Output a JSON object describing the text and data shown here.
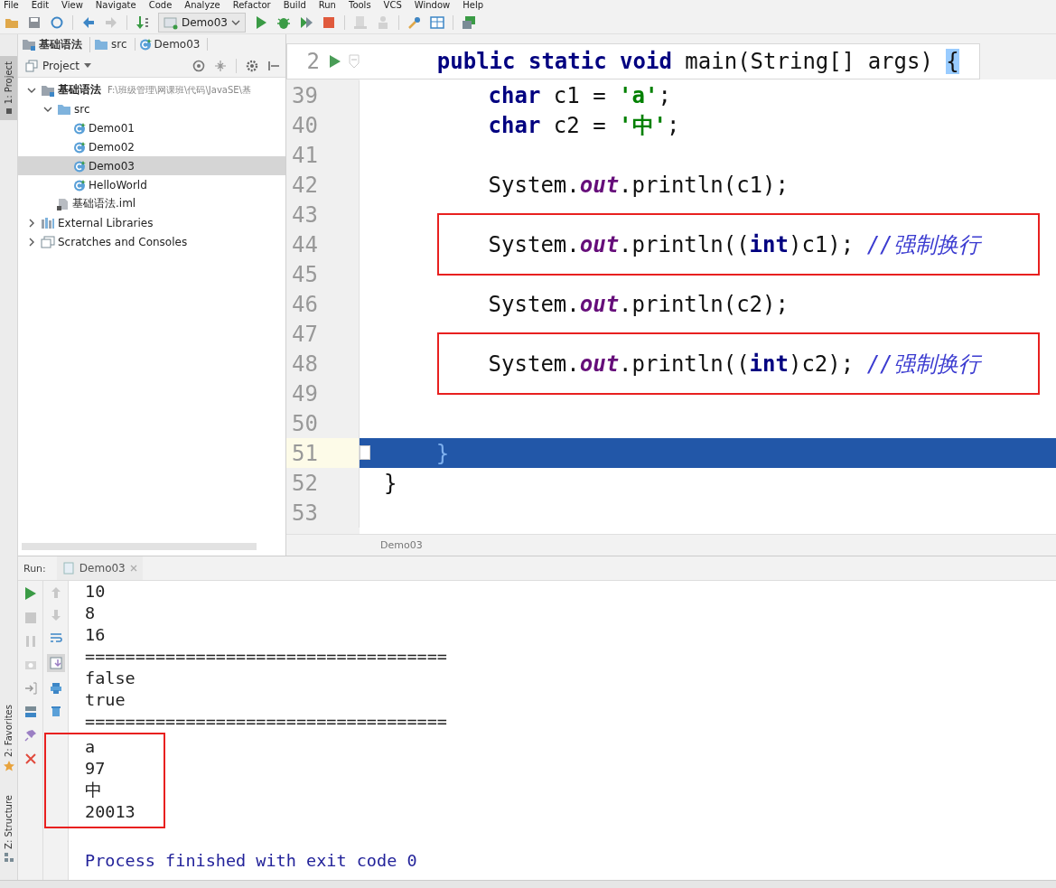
{
  "menu_bar": [
    "File",
    "Edit",
    "View",
    "Navigate",
    "Code",
    "Analyze",
    "Refactor",
    "Build",
    "Run",
    "Tools",
    "VCS",
    "Window",
    "Help"
  ],
  "toolbar": {
    "run_config": "Demo03"
  },
  "breadcrumbs": [
    {
      "label": "基础语法",
      "kind": "module"
    },
    {
      "label": "src",
      "kind": "folder"
    },
    {
      "label": "Demo03",
      "kind": "class"
    }
  ],
  "left_strip": {
    "top": [
      {
        "label": "1: Project",
        "selected": true
      }
    ],
    "bottom": [
      {
        "label": "2: Favorites",
        "selected": false
      },
      {
        "label": "Z: Structure",
        "selected": false
      }
    ]
  },
  "project_panel": {
    "title": "Project",
    "tree": [
      {
        "label": "基础语法",
        "path": "F:\\班级管理\\网课班\\代码\\JavaSE\\基",
        "kind": "module",
        "expanded": true,
        "selected": false,
        "children": [
          {
            "label": "src",
            "kind": "folder",
            "expanded": true,
            "selected": false,
            "children": [
              {
                "label": "Demo01",
                "kind": "class",
                "selected": false
              },
              {
                "label": "Demo02",
                "kind": "class",
                "selected": false
              },
              {
                "label": "Demo03",
                "kind": "class",
                "selected": true
              },
              {
                "label": "HelloWorld",
                "kind": "class",
                "selected": false
              }
            ]
          },
          {
            "label": "基础语法.iml",
            "kind": "file",
            "selected": false
          }
        ]
      },
      {
        "label": "External Libraries",
        "kind": "library",
        "expanded": false,
        "selected": false
      },
      {
        "label": "Scratches and Consoles",
        "kind": "scratch",
        "expanded": false,
        "selected": false
      }
    ]
  },
  "editor": {
    "sticky_line": {
      "number": "2",
      "tokens": [
        {
          "kind": "keyword",
          "text": "    public static void"
        },
        {
          "kind": "plain",
          "text": " main(String[] args) "
        },
        {
          "kind": "brace_match",
          "text": "{"
        }
      ]
    },
    "lines": [
      {
        "number": "39",
        "highlighted": false,
        "boxed": false,
        "tokens": [
          {
            "kind": "keyword",
            "text": "        char"
          },
          {
            "kind": "plain",
            "text": " c1 = "
          },
          {
            "kind": "string",
            "text": "'a'"
          },
          {
            "kind": "plain",
            "text": ";"
          }
        ]
      },
      {
        "number": "40",
        "highlighted": false,
        "boxed": false,
        "tokens": [
          {
            "kind": "keyword",
            "text": "        char"
          },
          {
            "kind": "plain",
            "text": " c2 = "
          },
          {
            "kind": "string",
            "text": "'中'"
          },
          {
            "kind": "plain",
            "text": ";"
          }
        ]
      },
      {
        "number": "41",
        "highlighted": false,
        "boxed": false
      },
      {
        "number": "42",
        "highlighted": false,
        "boxed": false,
        "tokens": [
          {
            "kind": "plain",
            "text": "        System."
          },
          {
            "kind": "field",
            "text": "out"
          },
          {
            "kind": "plain",
            "text": ".println(c1);"
          }
        ]
      },
      {
        "number": "43",
        "highlighted": false,
        "boxed": false
      },
      {
        "number": "44",
        "highlighted": false,
        "boxed": true,
        "tokens": [
          {
            "kind": "plain",
            "text": "        System."
          },
          {
            "kind": "field",
            "text": "out"
          },
          {
            "kind": "plain",
            "text": ".println(("
          },
          {
            "kind": "keyword",
            "text": "int"
          },
          {
            "kind": "plain",
            "text": ")c1); "
          },
          {
            "kind": "comment",
            "text": "//强制换行"
          }
        ]
      },
      {
        "number": "45",
        "highlighted": false,
        "boxed": false
      },
      {
        "number": "46",
        "highlighted": false,
        "boxed": false,
        "tokens": [
          {
            "kind": "plain",
            "text": "        System."
          },
          {
            "kind": "field",
            "text": "out"
          },
          {
            "kind": "plain",
            "text": ".println(c2);"
          }
        ]
      },
      {
        "number": "47",
        "highlighted": false,
        "boxed": false
      },
      {
        "number": "48",
        "highlighted": false,
        "boxed": true,
        "tokens": [
          {
            "kind": "plain",
            "text": "        System."
          },
          {
            "kind": "field",
            "text": "out"
          },
          {
            "kind": "plain",
            "text": ".println(("
          },
          {
            "kind": "keyword",
            "text": "int"
          },
          {
            "kind": "plain",
            "text": ")c2); "
          },
          {
            "kind": "comment",
            "text": "//强制换行"
          }
        ]
      },
      {
        "number": "49",
        "highlighted": false,
        "boxed": false
      },
      {
        "number": "50",
        "highlighted": false,
        "boxed": false
      },
      {
        "number": "51",
        "highlighted": true,
        "boxed": false,
        "tokens": [
          {
            "kind": "plain",
            "text": "    }"
          }
        ]
      },
      {
        "number": "52",
        "highlighted": false,
        "boxed": false,
        "tokens": [
          {
            "kind": "plain",
            "text": "}"
          }
        ]
      },
      {
        "number": "53",
        "highlighted": false,
        "boxed": false
      }
    ],
    "footer_label": "Demo03"
  },
  "run_panel": {
    "label": "Run:",
    "tab": "Demo03",
    "console": [
      {
        "text": "10",
        "kind": "output",
        "boxed": false
      },
      {
        "text": "8",
        "kind": "output",
        "boxed": false
      },
      {
        "text": "16",
        "kind": "output",
        "boxed": false
      },
      {
        "text": "====================================",
        "kind": "output",
        "boxed": false
      },
      {
        "text": "false",
        "kind": "output",
        "boxed": false
      },
      {
        "text": "true",
        "kind": "output",
        "boxed": false
      },
      {
        "text": "====================================",
        "kind": "output",
        "boxed": false
      },
      {
        "text": "a",
        "kind": "output",
        "boxed": true
      },
      {
        "text": "97",
        "kind": "output",
        "boxed": true
      },
      {
        "text": "中",
        "kind": "output",
        "boxed": true
      },
      {
        "text": "20013",
        "kind": "output",
        "boxed": true
      },
      {
        "text": "Process finished with exit code 0",
        "kind": "exit",
        "boxed": false
      }
    ]
  }
}
